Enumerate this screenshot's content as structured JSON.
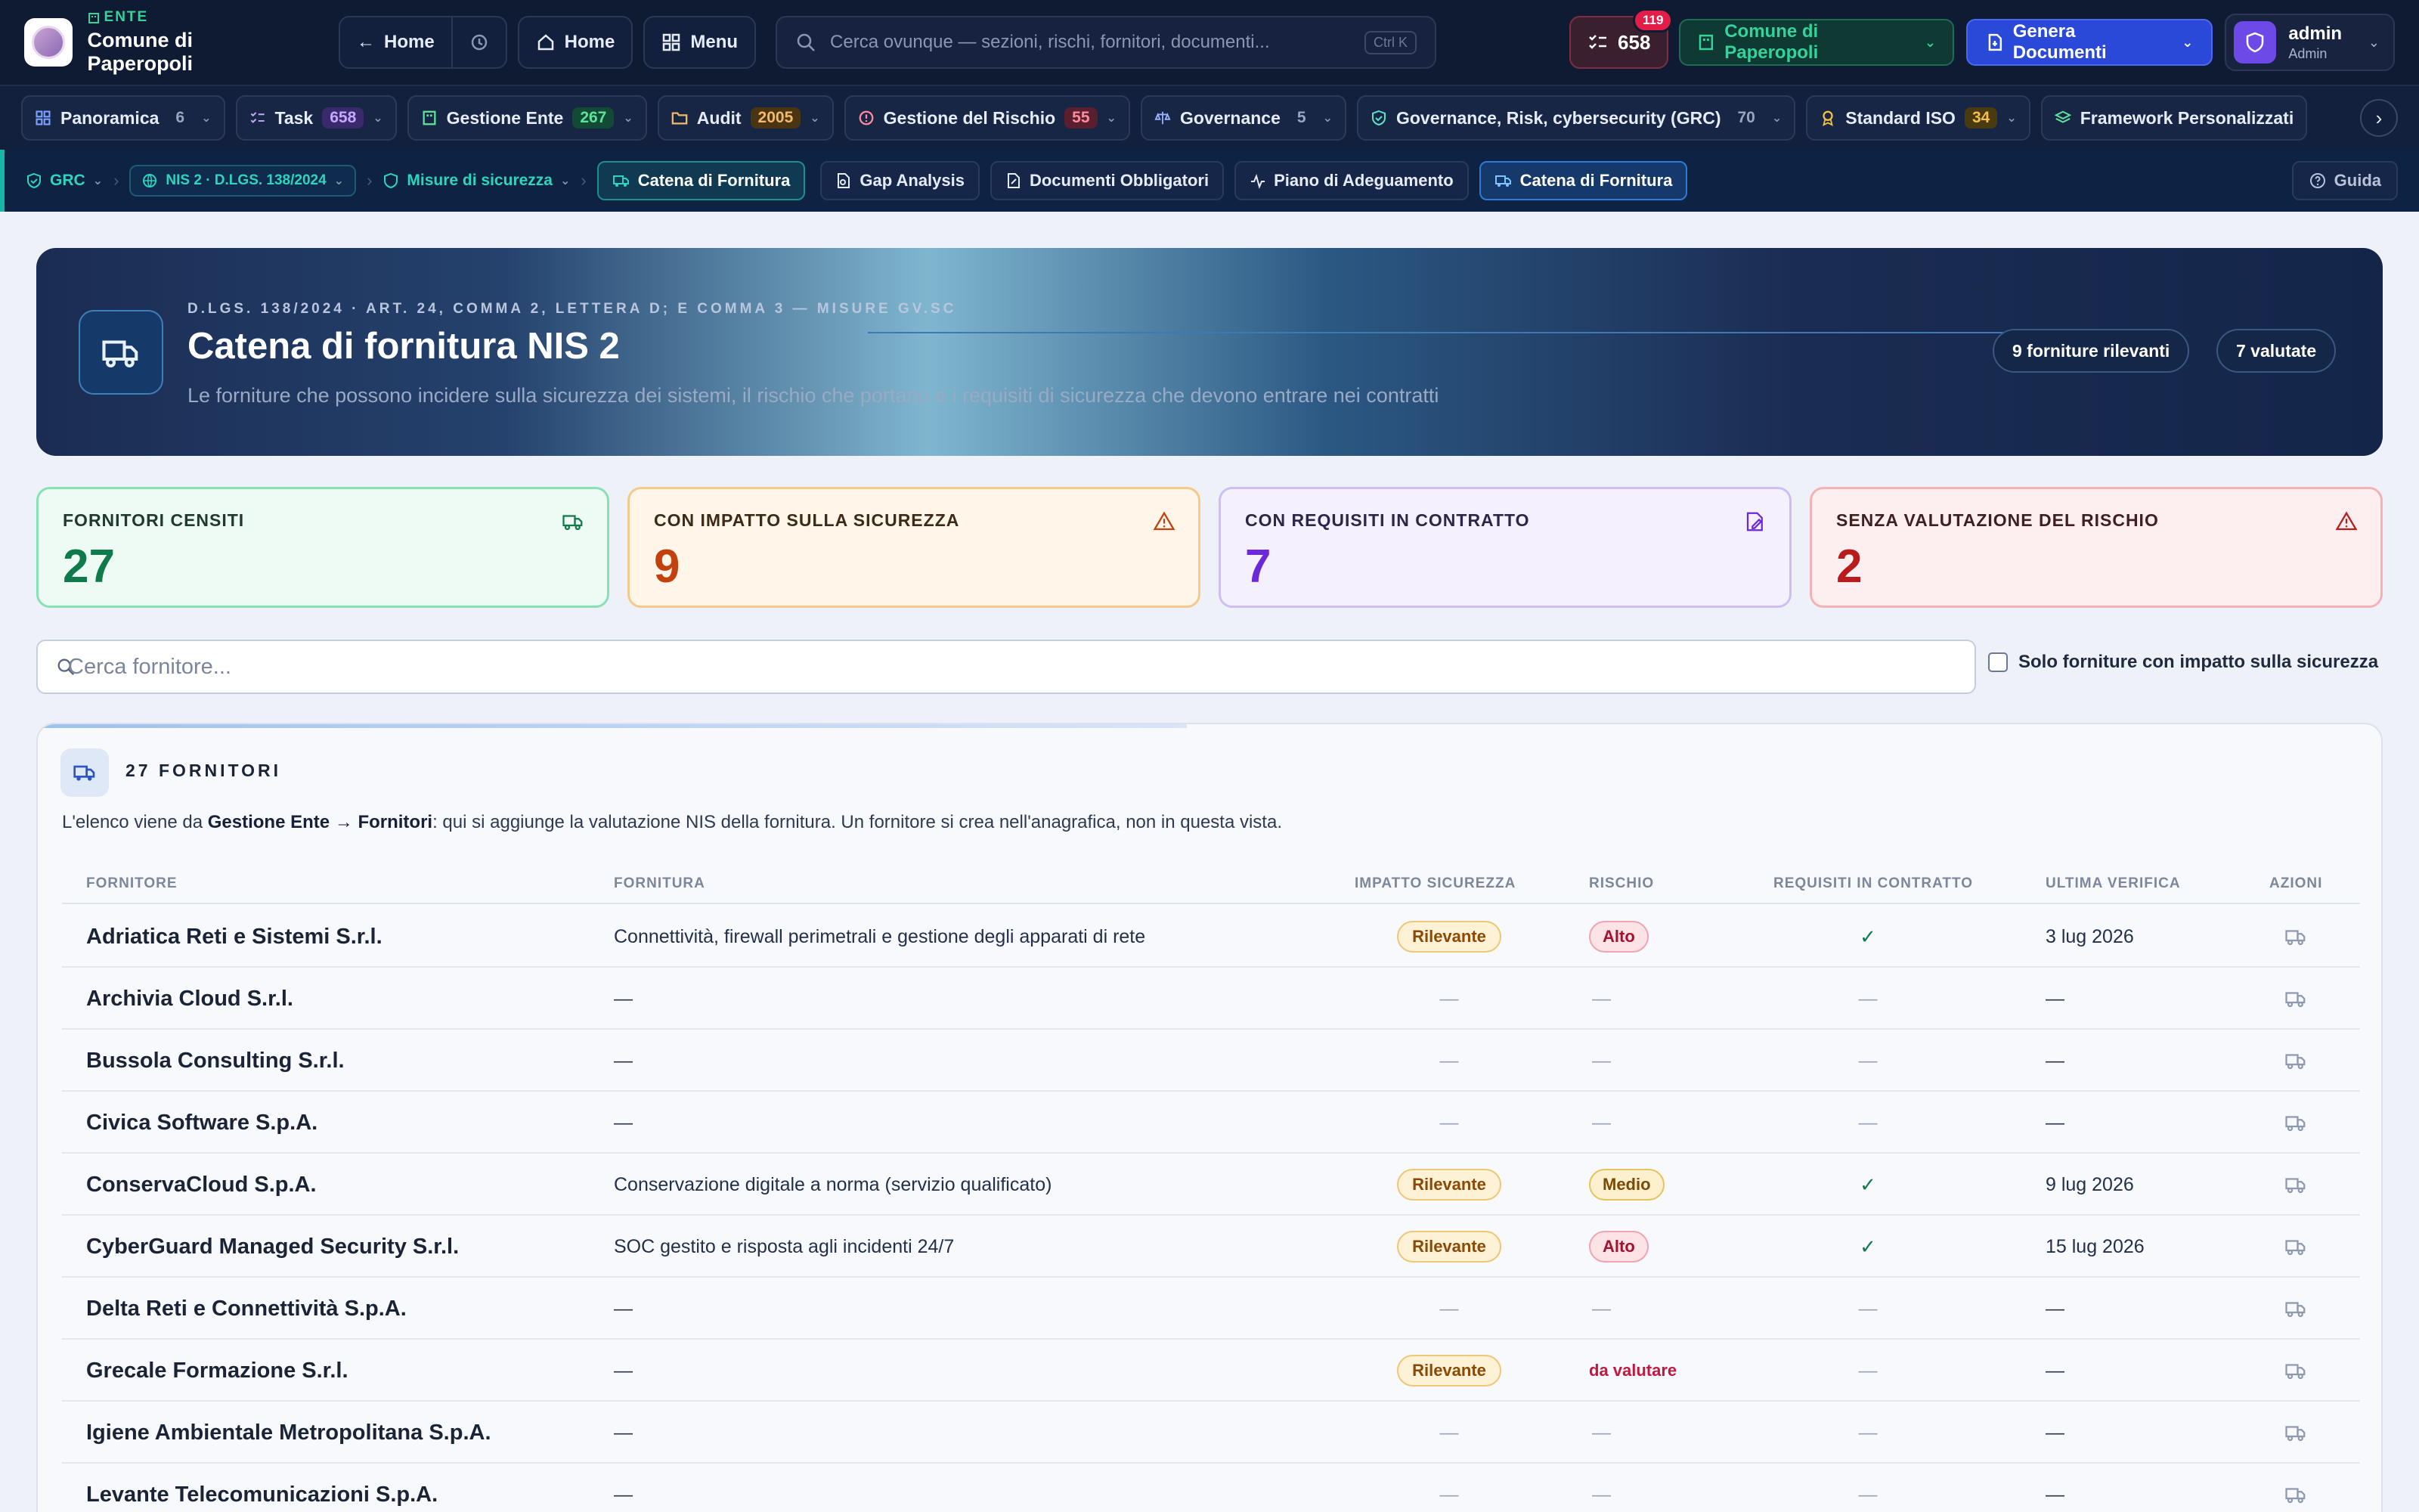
{
  "topbar": {
    "ente_tag": "ENTE",
    "ente_name": "Comune di Paperopoli",
    "back_home_label": "Home",
    "home_label": "Home",
    "menu_label": "Menu",
    "search_placeholder": "Cerca ovunque — sezioni, rischi, fornitori, documenti...",
    "search_shortcut": "Ctrl K",
    "tasks_count": "658",
    "tasks_badge": "119",
    "org_label": "Comune di Paperopoli",
    "generate_label": "Genera Documenti",
    "user_name": "admin",
    "user_role": "Admin"
  },
  "modules": [
    {
      "label": "Panoramica",
      "count": "6",
      "icon": "grid-icon",
      "color": "#9aa6c0",
      "bg": "transparent"
    },
    {
      "label": "Task",
      "count": "658",
      "icon": "checklist-icon",
      "color": "#c4a8ff",
      "bg": "#3b2a6b"
    },
    {
      "label": "Gestione Ente",
      "count": "267",
      "icon": "building-icon",
      "color": "#5be39a",
      "bg": "#124a36"
    },
    {
      "label": "Audit",
      "count": "2005",
      "icon": "folder-icon",
      "color": "#f2b96b",
      "bg": "#4a3412"
    },
    {
      "label": "Gestione del Rischio",
      "count": "55",
      "icon": "alert-circle-icon",
      "color": "#ff8a9b",
      "bg": "#5a1f2e"
    },
    {
      "label": "Governance",
      "count": "5",
      "icon": "scale-icon",
      "color": "#9aa6c0",
      "bg": "transparent"
    },
    {
      "label": "Governance, Risk, cybersecurity (GRC)",
      "count": "70",
      "icon": "shield-check-icon",
      "color": "#9aa6c0",
      "bg": "transparent"
    },
    {
      "label": "Standard ISO",
      "count": "34",
      "icon": "award-icon",
      "color": "#f5c04a",
      "bg": "#4a3a10"
    },
    {
      "label": "Framework Personalizzati",
      "count": "",
      "icon": "layers-icon",
      "color": "#9aa6c0",
      "bg": "transparent"
    }
  ],
  "subnav": {
    "crumb_grc": "GRC",
    "crumb_nis": "NIS 2 · D.LGS. 138/2024",
    "crumb_misure": "Misure di sicurezza",
    "crumb_current": "Catena di Fornitura",
    "tabs": [
      "Gap Analysis",
      "Documenti Obbligatori",
      "Piano di Adeguamento",
      "Catena di Fornitura"
    ],
    "guide_label": "Guida"
  },
  "hero": {
    "kicker": "D.LGS. 138/2024 · ART. 24, COMMA 2, LETTERA D; E COMMA 3 — MISURE GV.SC",
    "title": "Catena di fornitura NIS 2",
    "subtitle": "Le forniture che possono incidere sulla sicurezza dei sistemi, il rischio che portano e i requisiti di sicurezza che devono entrare nei contratti",
    "pill_relevant": "9 forniture rilevanti",
    "pill_evaluated": "7 valutate"
  },
  "stats": [
    {
      "label": "FORNITORI CENSITI",
      "value": "27",
      "icon": "truck-icon",
      "color": "#0f7a4b",
      "border": "#86e2b4",
      "bg": "#eefbf4",
      "label_color": "#1f3a30"
    },
    {
      "label": "CON IMPATTO SULLA SICUREZZA",
      "value": "9",
      "icon": "warning-icon",
      "color": "#c2410c",
      "border": "#f5c98a",
      "bg": "#fff5e8",
      "label_color": "#3d2a18"
    },
    {
      "label": "CON REQUISITI IN CONTRATTO",
      "value": "7",
      "icon": "edit-icon",
      "color": "#6d28d9",
      "border": "#cdbff3",
      "bg": "#f4f0fd",
      "label_color": "#2e2648"
    },
    {
      "label": "SENZA VALUTAZIONE DEL RISCHIO",
      "value": "2",
      "icon": "warning-triangle-icon",
      "color": "#b91c1c",
      "border": "#f5b1b5",
      "bg": "#fdefef",
      "label_color": "#3f1f22"
    }
  ],
  "filter": {
    "search_placeholder": "Cerca fornitore...",
    "checkbox_label": "Solo forniture con impatto sulla sicurezza"
  },
  "table": {
    "title": "27 FORNITORI",
    "desc_prefix": "L'elenco viene da ",
    "desc_bold": "Gestione Ente → Fornitori",
    "desc_suffix": ": qui si aggiunge la valutazione NIS della fornitura. Un fornitore si crea nell'anagrafica, non in questa vista.",
    "headers": [
      "FORNITORE",
      "FORNITURA",
      "IMPATTO SICUREZZA",
      "RISCHIO",
      "REQUISITI IN CONTRATTO",
      "ULTIMA VERIFICA",
      "AZIONI"
    ],
    "rows": [
      {
        "name": "Adriatica Reti e Sistemi S.r.l.",
        "fornitura": "Connettività, firewall perimetrali e gestione degli apparati di rete",
        "impatto": "Rilevante",
        "rischio": "Alto",
        "rischio_type": "alto",
        "requisiti": "✓",
        "verifica": "3 lug 2026"
      },
      {
        "name": "Archivia Cloud S.r.l.",
        "fornitura": "—",
        "impatto": "—",
        "rischio": "—",
        "rischio_type": "none",
        "requisiti": "—",
        "verifica": "—"
      },
      {
        "name": "Bussola Consulting S.r.l.",
        "fornitura": "—",
        "impatto": "—",
        "rischio": "—",
        "rischio_type": "none",
        "requisiti": "—",
        "verifica": "—"
      },
      {
        "name": "Civica Software S.p.A.",
        "fornitura": "—",
        "impatto": "—",
        "rischio": "—",
        "rischio_type": "none",
        "requisiti": "—",
        "verifica": "—"
      },
      {
        "name": "ConservaCloud S.p.A.",
        "fornitura": "Conservazione digitale a norma (servizio qualificato)",
        "impatto": "Rilevante",
        "rischio": "Medio",
        "rischio_type": "medio",
        "requisiti": "✓",
        "verifica": "9 lug 2026"
      },
      {
        "name": "CyberGuard Managed Security S.r.l.",
        "fornitura": "SOC gestito e risposta agli incidenti 24/7",
        "impatto": "Rilevante",
        "rischio": "Alto",
        "rischio_type": "alto",
        "requisiti": "✓",
        "verifica": "15 lug 2026"
      },
      {
        "name": "Delta Reti e Connettività S.p.A.",
        "fornitura": "—",
        "impatto": "—",
        "rischio": "—",
        "rischio_type": "none",
        "requisiti": "—",
        "verifica": "—"
      },
      {
        "name": "Grecale Formazione S.r.l.",
        "fornitura": "—",
        "impatto": "Rilevante",
        "rischio": "da valutare",
        "rischio_type": "pending",
        "requisiti": "—",
        "verifica": "—"
      },
      {
        "name": "Igiene Ambientale Metropolitana S.p.A.",
        "fornitura": "—",
        "impatto": "—",
        "rischio": "—",
        "rischio_type": "none",
        "requisiti": "—",
        "verifica": "—"
      },
      {
        "name": "Levante Telecomunicazioni S.p.A.",
        "fornitura": "—",
        "impatto": "—",
        "rischio": "—",
        "rischio_type": "none",
        "requisiti": "—",
        "verifica": "—"
      }
    ]
  }
}
